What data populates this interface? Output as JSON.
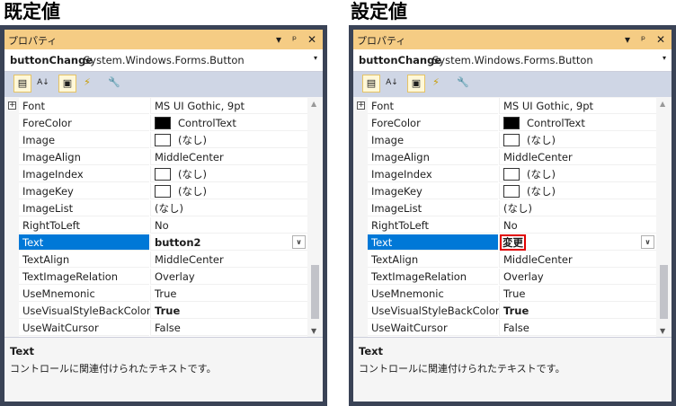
{
  "captions": {
    "left": "既定値",
    "right": "設定値"
  },
  "window": {
    "title": "プロパティ",
    "title_buttons": [
      "▾",
      "ᵖ",
      "✕"
    ],
    "object_name": "buttonChange",
    "object_type": "System.Windows.Forms.Button",
    "dropdown_arrow": "▾"
  },
  "toolbar": {
    "icons": [
      "categorized-icon",
      "alphabetical-icon",
      "properties-icon",
      "events-icon",
      "property-pages-icon"
    ],
    "glyphs": [
      "▤",
      "A↓",
      "▣",
      "⚡",
      "🔧"
    ]
  },
  "plus_glyph": "+",
  "combo_glyph": "∨",
  "scroll": {
    "up": "▲",
    "down": "▼"
  },
  "panels": [
    {
      "rows": [
        {
          "name": "Font",
          "value": "MS UI Gothic, 9pt"
        },
        {
          "name": "ForeColor",
          "value": "ControlText"
        },
        {
          "name": "Image",
          "value": "(なし)"
        },
        {
          "name": "ImageAlign",
          "value": "MiddleCenter"
        },
        {
          "name": "ImageIndex",
          "value": "(なし)"
        },
        {
          "name": "ImageKey",
          "value": "(なし)"
        },
        {
          "name": "ImageList",
          "value": "(なし)"
        },
        {
          "name": "RightToLeft",
          "value": "No"
        },
        {
          "name": "Text",
          "value": "button2"
        },
        {
          "name": "TextAlign",
          "value": "MiddleCenter"
        },
        {
          "name": "TextImageRelation",
          "value": "Overlay"
        },
        {
          "name": "UseMnemonic",
          "value": "True"
        },
        {
          "name": "UseVisualStyleBackColor",
          "value": "True"
        },
        {
          "name": "UseWaitCursor",
          "value": "False"
        }
      ],
      "description": {
        "title": "Text",
        "text": "コントロールに関連付けられたテキストです。"
      }
    },
    {
      "rows": [
        {
          "name": "Font",
          "value": "MS UI Gothic, 9pt"
        },
        {
          "name": "ForeColor",
          "value": "ControlText"
        },
        {
          "name": "Image",
          "value": "(なし)"
        },
        {
          "name": "ImageAlign",
          "value": "MiddleCenter"
        },
        {
          "name": "ImageIndex",
          "value": "(なし)"
        },
        {
          "name": "ImageKey",
          "value": "(なし)"
        },
        {
          "name": "ImageList",
          "value": "(なし)"
        },
        {
          "name": "RightToLeft",
          "value": "No"
        },
        {
          "name": "Text",
          "value": "変更"
        },
        {
          "name": "TextAlign",
          "value": "MiddleCenter"
        },
        {
          "name": "TextImageRelation",
          "value": "Overlay"
        },
        {
          "name": "UseMnemonic",
          "value": "True"
        },
        {
          "name": "UseVisualStyleBackColor",
          "value": "True"
        },
        {
          "name": "UseWaitCursor",
          "value": "False"
        }
      ],
      "description": {
        "title": "Text",
        "text": "コントロールに関連付けられたテキストです。"
      }
    }
  ],
  "colors": {
    "title_bar": "#f5cc84",
    "selection": "#0078d7",
    "frame": "#3a4356",
    "highlight_box": "#e00000"
  }
}
